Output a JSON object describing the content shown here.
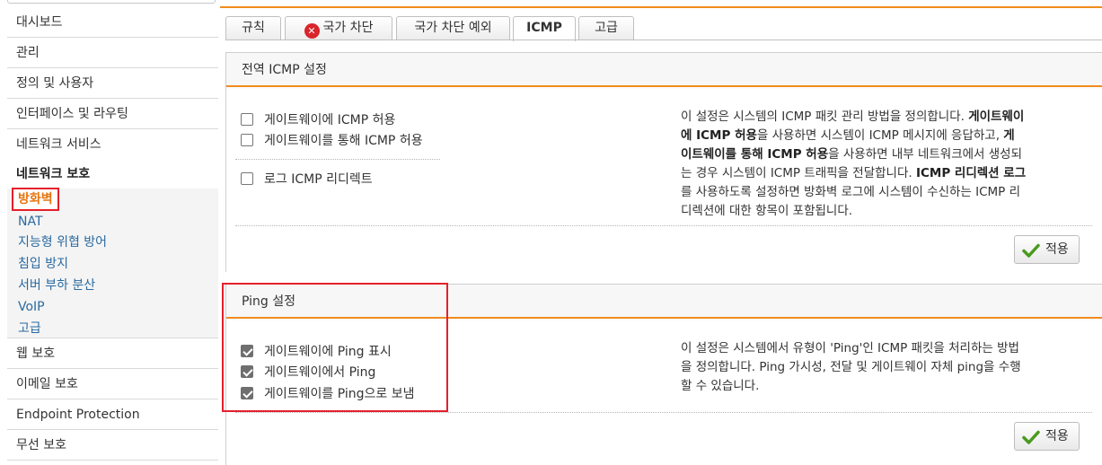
{
  "sidebar": {
    "items": [
      {
        "label": "대시보드"
      },
      {
        "label": "관리"
      },
      {
        "label": "정의 및 사용자"
      },
      {
        "label": "인터페이스 및 라우팅"
      },
      {
        "label": "네트워크 서비스"
      }
    ],
    "section": {
      "label": "네트워크 보호"
    },
    "sub_items": [
      {
        "label": "방화벽",
        "active": true
      },
      {
        "label": "NAT"
      },
      {
        "label": "지능형 위협 방어"
      },
      {
        "label": "침입 방지"
      },
      {
        "label": "서버 부하 분산"
      },
      {
        "label": "VoIP"
      },
      {
        "label": "고급"
      }
    ],
    "items_after": [
      {
        "label": "웹 보호"
      },
      {
        "label": "이메일 보호"
      },
      {
        "label": "Endpoint Protection"
      },
      {
        "label": "무선 보호"
      }
    ]
  },
  "tabs": [
    {
      "label": "규칙"
    },
    {
      "label": "국가 차단",
      "icon": "close-icon"
    },
    {
      "label": "국가 차단 예외"
    },
    {
      "label": "ICMP",
      "active": true
    },
    {
      "label": "고급"
    }
  ],
  "global_icmp": {
    "title": "전역 ICMP 설정",
    "options": [
      {
        "label": "게이트웨이에 ICMP 허용",
        "checked": false
      },
      {
        "label": "게이트웨이를 통해 ICMP 허용",
        "checked": false
      },
      {
        "label": "로그 ICMP 리디렉트",
        "checked": false
      }
    ],
    "description": {
      "l1a": "이 설정은 시스템의 ICMP 패킷 관리 방법을 정의합니다. ",
      "l1b": "게이트웨이",
      "l2a": "에 ICMP 허용",
      "l2b": "을 사용하면 시스템이 ICMP 메시지에 응답하고, ",
      "l2c": "게",
      "l3a": "이트웨이를 통해 ICMP 허용",
      "l3b": "을 사용하면 내부 네트워크에서 생성되",
      "l4a": "는 경우 시스템이 ICMP 트래픽을 전달합니다. ",
      "l4b": "ICMP 리디렉션 로그",
      "l5": "를 사용하도록 설정하면 방화벽 로그에 시스템이 수신하는 ICMP 리",
      "l6": "디렉션에 대한 항목이 포함됩니다."
    },
    "apply_label": "적용"
  },
  "ping": {
    "title": "Ping 설정",
    "options": [
      {
        "label": "게이트웨이에 Ping 표시",
        "checked": true
      },
      {
        "label": "게이트웨이에서 Ping",
        "checked": true
      },
      {
        "label": "게이트웨이를 Ping으로 보냄",
        "checked": true
      }
    ],
    "description": {
      "l1": "이 설정은 시스템에서 유형이 'Ping'인 ICMP 패킷을 처리하는 방법",
      "l2": "을 정의합니다. Ping 가시성, 전달 및 게이트웨이 자체 ping을 수행",
      "l3": "할 수 있습니다."
    },
    "apply_label": "적용"
  },
  "colors": {
    "accent_orange": "#f08c1e",
    "highlight_red": "#e5202c",
    "link_blue": "#2a6aa0",
    "active_orange": "#e8740c"
  }
}
